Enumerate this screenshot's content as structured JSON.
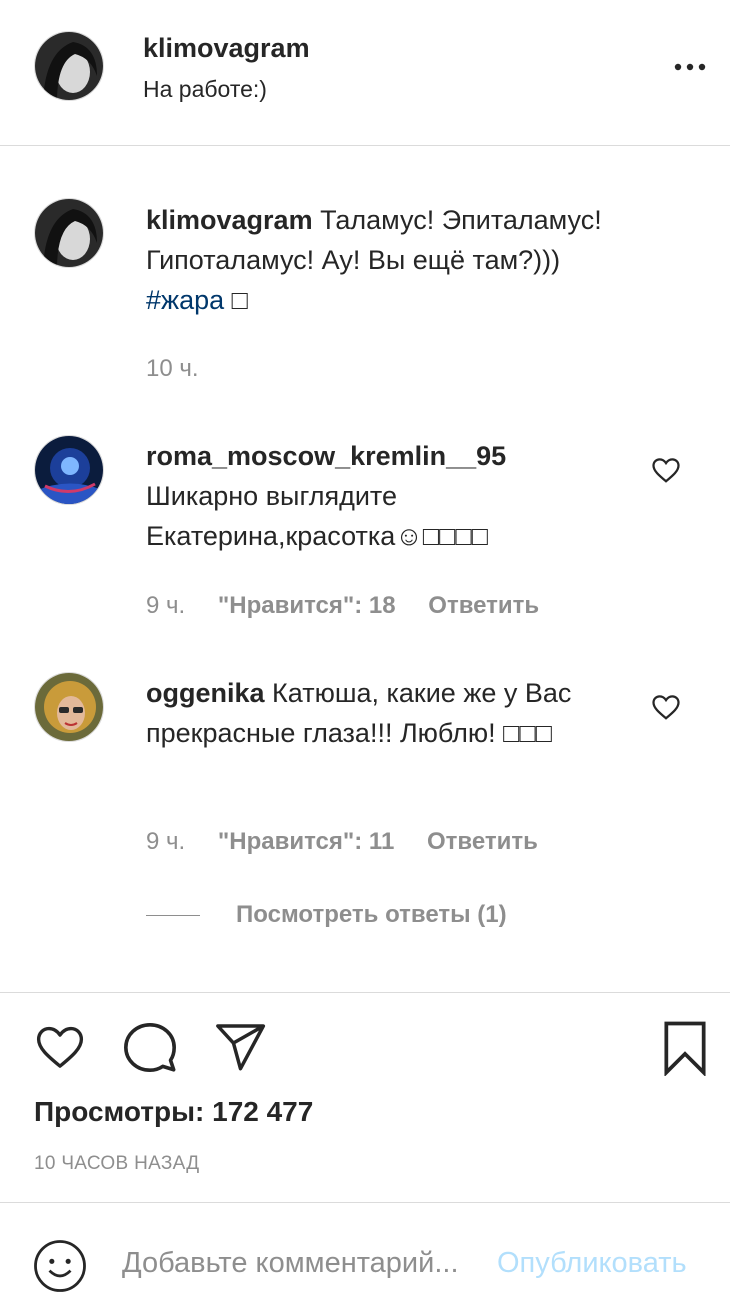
{
  "header": {
    "username": "klimovagram",
    "location": "На работе:)",
    "more": "..."
  },
  "caption": {
    "username": "klimovagram",
    "text": "Таламус! Эпиталамус! Гипоталамус! Ау! Вы ещё там?)))",
    "hashtag": "#жара",
    "emoji": "□",
    "time": "10 ч."
  },
  "comments": [
    {
      "username": "roma_moscow_kremlin__95",
      "text": "Шикарно выглядите Екатерина,красотка☺□□□□",
      "time": "9 ч.",
      "likes": "\"Нравится\": 18",
      "reply": "Ответить"
    },
    {
      "username": "oggenika",
      "text": "Катюша, какие же у Вас прекрасные глаза!!! Люблю! □□□",
      "time": "9 ч.",
      "likes": "\"Нравится\": 11",
      "reply": "Ответить",
      "view_replies": "Посмотреть ответы (1)"
    }
  ],
  "actions": {
    "icons": [
      "heart-icon",
      "comment-icon",
      "share-icon",
      "bookmark-icon"
    ]
  },
  "views": "Просмотры: 172 477",
  "timestamp": "10 ЧАСОВ НАЗАД",
  "composer": {
    "placeholder": "Добавьте комментарий...",
    "publish": "Опубликовать"
  }
}
